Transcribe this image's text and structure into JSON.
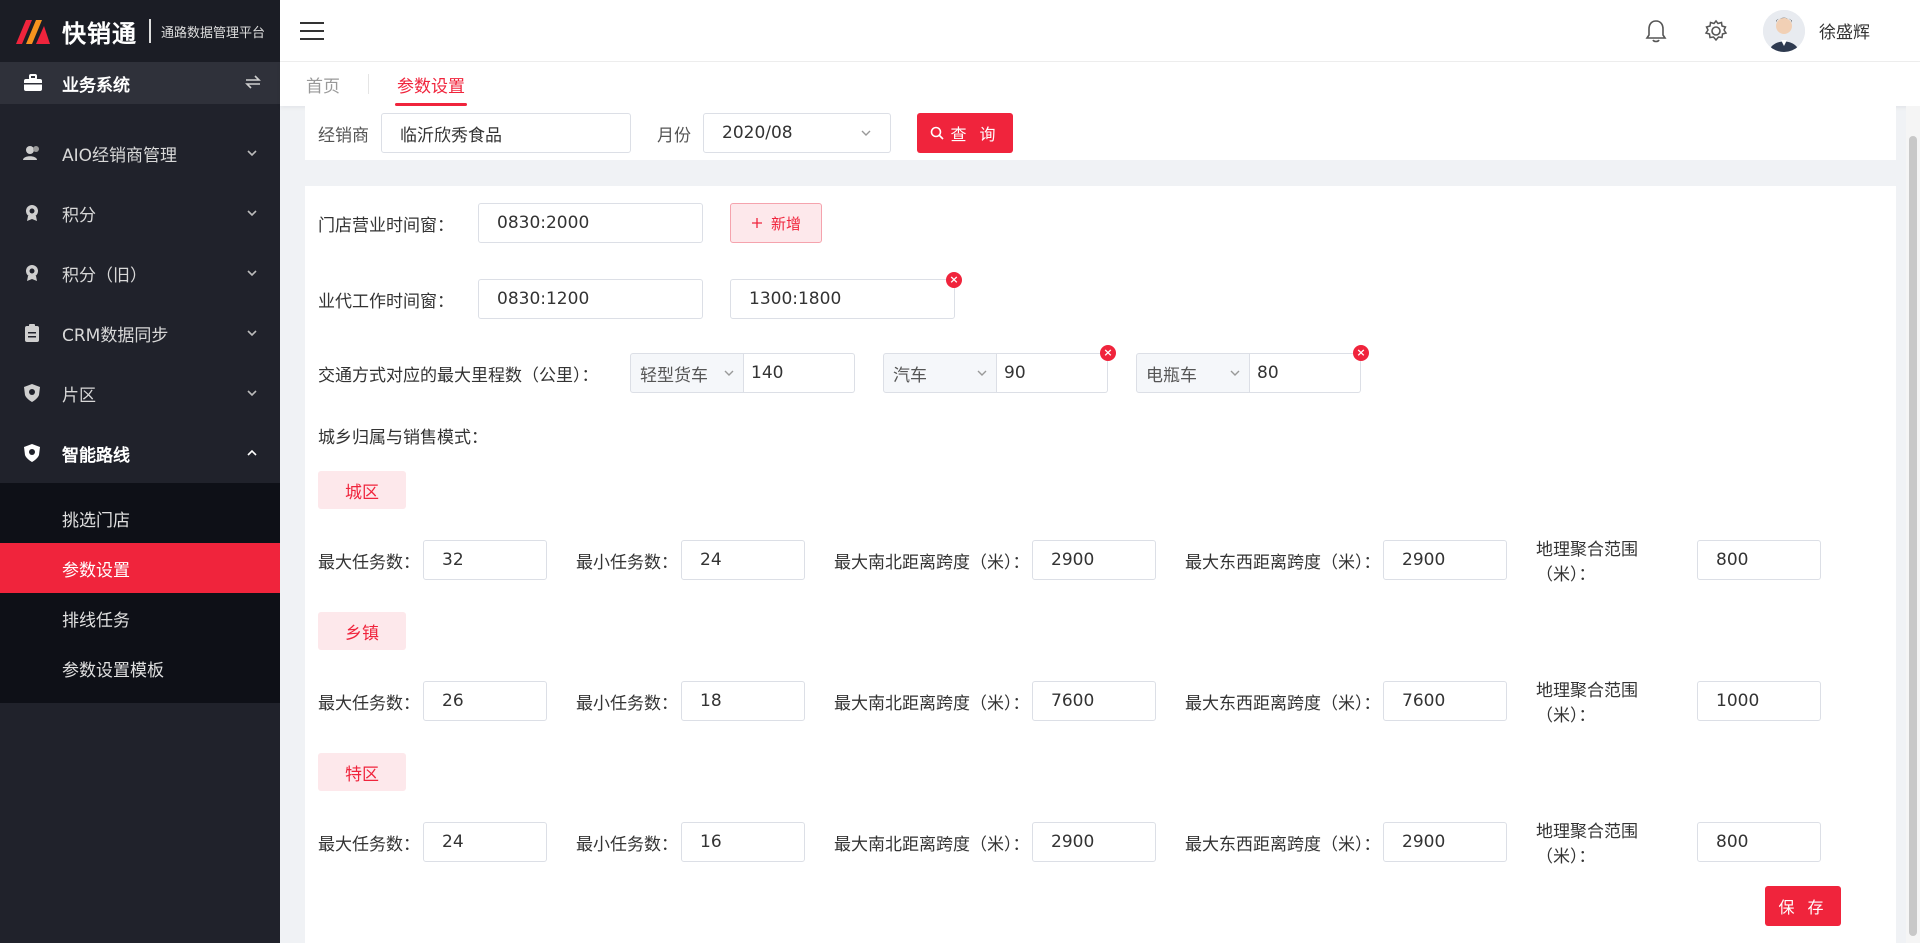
{
  "app": {
    "name": "快销通",
    "subtitle": "通路数据管理平台"
  },
  "sidebar": {
    "system_label": "业务系统",
    "menu": [
      {
        "label": "AIO经销商管理",
        "icon": "user-group-icon"
      },
      {
        "label": "积分",
        "icon": "medal-icon"
      },
      {
        "label": "积分（旧）",
        "icon": "medal-icon"
      },
      {
        "label": "CRM数据同步",
        "icon": "clipboard-icon"
      },
      {
        "label": "片区",
        "icon": "shield-icon"
      },
      {
        "label": "智能路线",
        "icon": "shield-icon"
      }
    ],
    "submenu": [
      "挑选门店",
      "参数设置",
      "排线任务",
      "参数设置模板"
    ]
  },
  "header": {
    "user_name": "徐盛辉"
  },
  "tabs": [
    "首页",
    "参数设置"
  ],
  "filter": {
    "dealer_label": "经销商",
    "dealer_value": "临沂欣秀食品",
    "month_label": "月份",
    "month_value": "2020/08",
    "query_label": "查 询"
  },
  "form": {
    "store_hours_label": "门店营业时间窗：",
    "store_hours": [
      "0830:2000"
    ],
    "add_label": "新增",
    "agent_hours_label": "业代工作时间窗：",
    "agent_hours": [
      "0830:1200",
      "1300:1800"
    ],
    "transport_label": "交通方式对应的最大里程数（公里）：",
    "transport": [
      {
        "mode": "轻型货车",
        "value": "140"
      },
      {
        "mode": "汽车",
        "value": "90"
      },
      {
        "mode": "电瓶车",
        "value": "80"
      }
    ],
    "zone_label": "城乡归属与销售模式：",
    "field_labels": {
      "max_tasks": "最大任务数：",
      "min_tasks": "最小任务数：",
      "ns_span": "最大南北距离跨度（米）：",
      "ew_span": "最大东西距离跨度（米）：",
      "cluster": "地理聚合范围（米）："
    },
    "zones": [
      {
        "name": "城区",
        "max_tasks": "32",
        "min_tasks": "24",
        "ns_span": "2900",
        "ew_span": "2900",
        "cluster": "800"
      },
      {
        "name": "乡镇",
        "max_tasks": "26",
        "min_tasks": "18",
        "ns_span": "7600",
        "ew_span": "7600",
        "cluster": "1000"
      },
      {
        "name": "特区",
        "max_tasks": "24",
        "min_tasks": "16",
        "ns_span": "2900",
        "ew_span": "2900",
        "cluster": "800"
      }
    ],
    "save_label": "保 存"
  },
  "colors": {
    "accent": "#f0243c",
    "sidebar_bg": "#20222b"
  }
}
